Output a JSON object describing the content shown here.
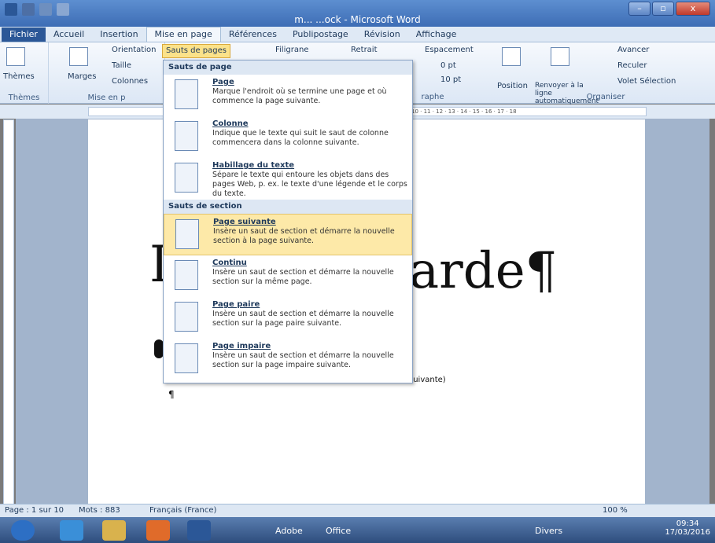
{
  "window": {
    "title": "m... ...ock - Microsoft Word"
  },
  "tabs": [
    "Fichier",
    "Accueil",
    "Insertion",
    "Mise en page",
    "Références",
    "Publipostage",
    "Révision",
    "Affichage"
  ],
  "ribbon": {
    "orientation": "Orientation",
    "taille": "Taille",
    "colonnes": "Colonnes",
    "sauts": "Sauts de pages",
    "filigrane": "Filigrane",
    "retrait": "Retrait",
    "espacement": "Espacement",
    "esp_before": "0 pt",
    "esp_after": "10 pt",
    "position": "Position",
    "renvoyer": "Renvoyer à la ligne automatiquement",
    "avancer": "Avancer",
    "reculer": "Reculer",
    "volet": "Volet Sélection",
    "themes": "Thèmes",
    "marges": "Marges",
    "group_themes": "Thèmes",
    "group_mise": "Mise en p",
    "group_para": "raphe",
    "group_org": "Organiser"
  },
  "menu": {
    "sec1": "Sauts de page",
    "sec2": "Sauts de section",
    "items": [
      {
        "title": "Page",
        "desc": "Marque l'endroit où se termine une page et où commence la page suivante."
      },
      {
        "title": "Colonne",
        "desc": "Indique que le texte qui suit le saut de colonne commencera dans la colonne suivante."
      },
      {
        "title": "Habillage du texte",
        "desc": "Sépare le texte qui entoure les objets dans des pages Web, p. ex. le texte d'une légende et le corps du texte."
      },
      {
        "title": "Page suivante",
        "desc": "Insère un saut de section et démarre la nouvelle section à la page suivante."
      },
      {
        "title": "Continu",
        "desc": "Insère un saut de section et démarre la nouvelle section sur la même page."
      },
      {
        "title": "Page paire",
        "desc": "Insère un saut de section et démarre la nouvelle section sur la page paire suivante."
      },
      {
        "title": "Page impaire",
        "desc": "Insère un saut de section et démarre la nouvelle section sur la page impaire suivante."
      }
    ]
  },
  "document": {
    "big_left": "I",
    "big_right": "arde¶",
    "link": "suivante)",
    "cursor": "¶"
  },
  "ruler": {
    "marks": "10 · 11 · 12 · 13 · 14 · 15 · 16 · 17 · 18"
  },
  "status": {
    "page": "Page : 1 sur 10",
    "words": "Mots : 883",
    "lang": "Français (France)",
    "zoom": "100 %"
  },
  "taskbar": {
    "adobe": "Adobe",
    "office": "Office",
    "divers": "Divers",
    "time": "09:34",
    "date": "17/03/2016"
  },
  "colors": {
    "accent": "#2b5797",
    "highlight": "#fde9a8"
  }
}
